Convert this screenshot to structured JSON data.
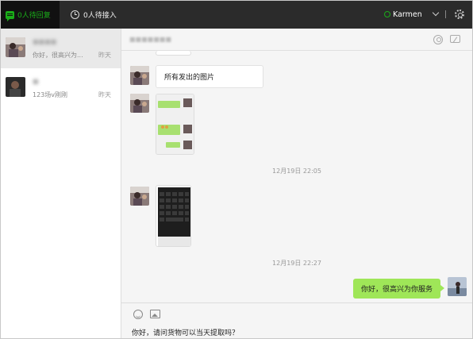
{
  "topbar": {
    "tab_reply": "0人待回复",
    "tab_access": "0人待接入",
    "user_name": "Karmen"
  },
  "sidebar": {
    "conversations": [
      {
        "preview": "你好，很高兴为...",
        "time": "昨天"
      },
      {
        "preview": "123场v刚刚",
        "time": "昨天"
      }
    ]
  },
  "chat": {
    "messages": [
      {
        "text": "所有发出的图片"
      }
    ],
    "timestamps": [
      "12月19日 22:05",
      "12月19日 22:27"
    ],
    "outgoing": "你好，很高兴为你服务"
  },
  "composer": {
    "draft": "你好，请问货物可以当天提取吗？"
  },
  "colors": {
    "accent": "#1aad19",
    "topbar": "#2b2b2b",
    "bubble_out": "#9fe658"
  }
}
